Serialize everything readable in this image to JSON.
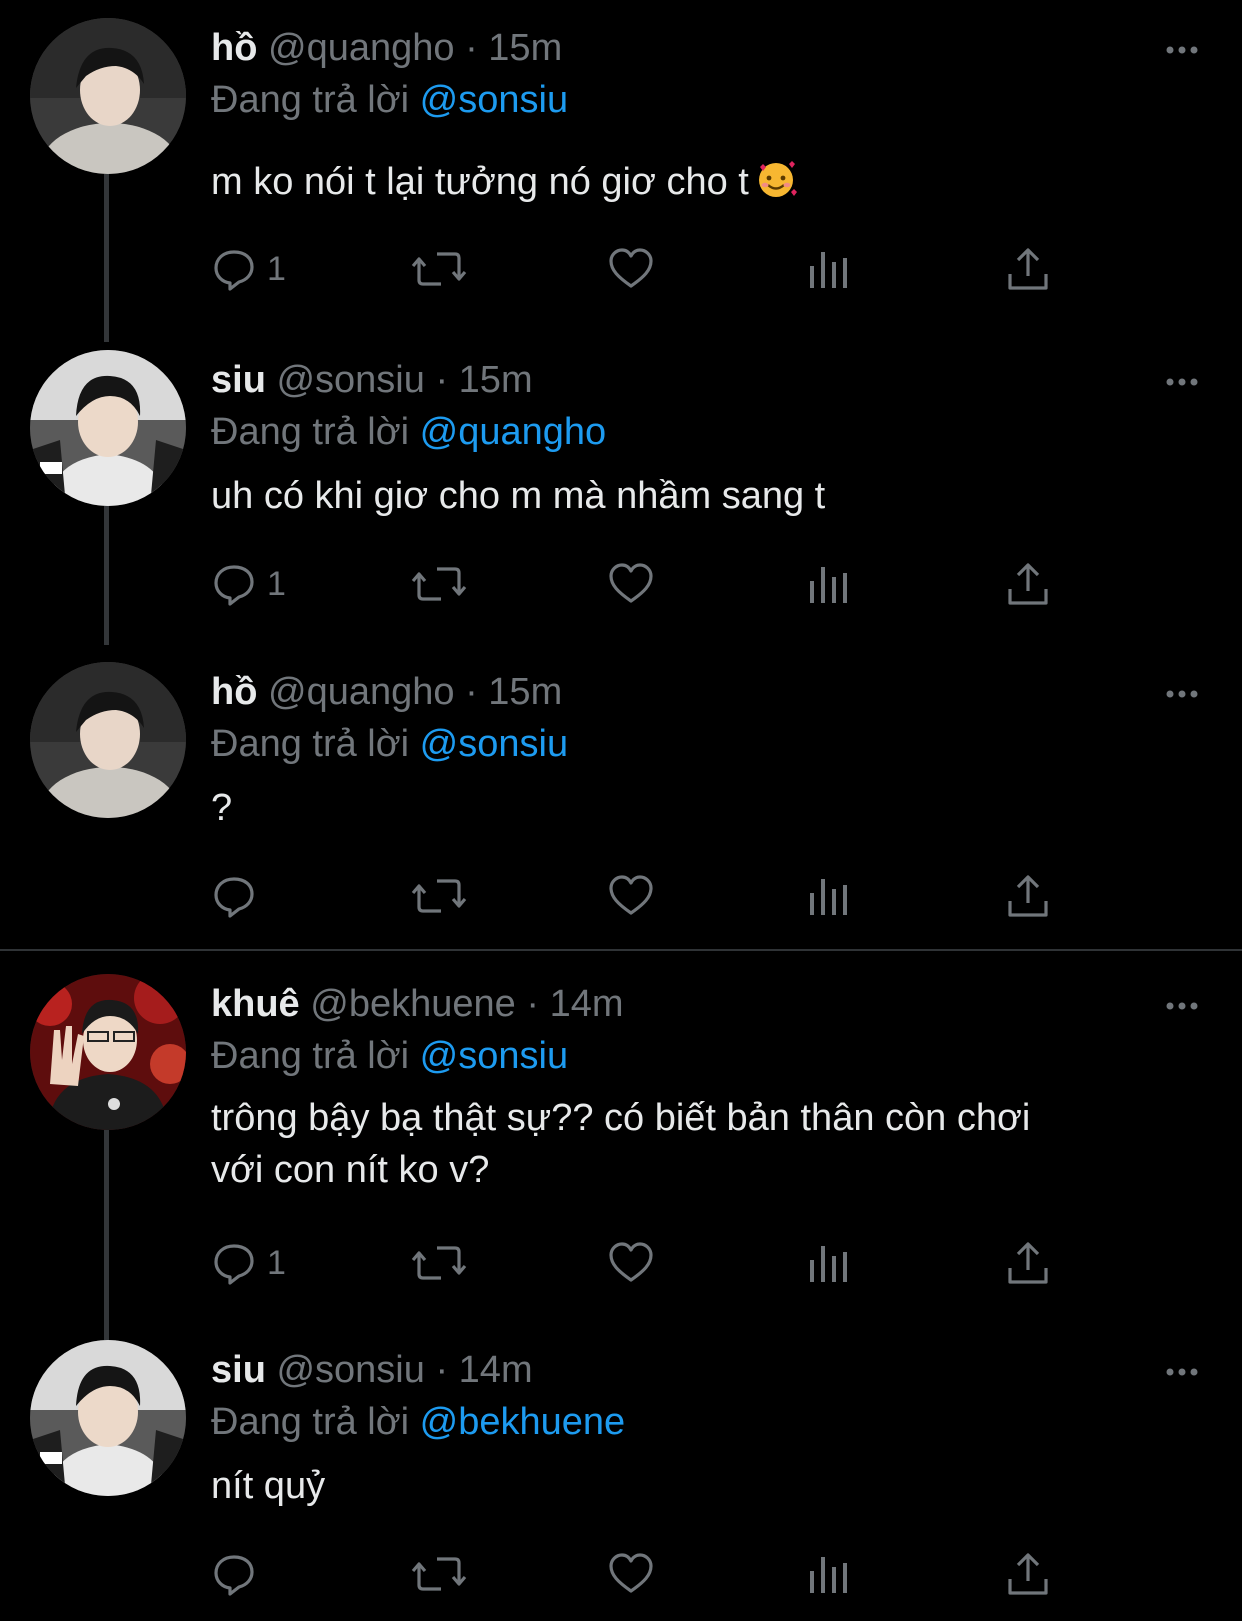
{
  "colors": {
    "background": "#000000",
    "primary_text": "#e7e9ea",
    "secondary_text": "#71767b",
    "link": "#1d9bf0",
    "thread_line": "#333639"
  },
  "tweets": [
    {
      "name": "hồ",
      "handle": "@quangho",
      "separator": "·",
      "time": "15m",
      "reply_prefix": "Đang trả lời",
      "reply_to": "@sonsiu",
      "text": "m ko nói t lại tưởng nó giơ cho t",
      "emoji": "smiling-face-with-hearts",
      "reply_count": "1"
    },
    {
      "name": "siu",
      "handle": "@sonsiu",
      "separator": "·",
      "time": "15m",
      "reply_prefix": "Đang trả lời",
      "reply_to": "@quangho",
      "text": "uh có khi giơ cho m mà nhầm sang t",
      "reply_count": "1"
    },
    {
      "name": "hồ",
      "handle": "@quangho",
      "separator": "·",
      "time": "15m",
      "reply_prefix": "Đang trả lời",
      "reply_to": "@sonsiu",
      "text": "?",
      "reply_count": ""
    },
    {
      "name": "khuê",
      "handle": "@bekhuene",
      "separator": "·",
      "time": "14m",
      "reply_prefix": "Đang trả lời",
      "reply_to": "@sonsiu",
      "text_line1": "trông bậy bạ thật sự?? có biết bản thân còn chơi",
      "text_line2": "với con nít ko v?",
      "reply_count": "1"
    },
    {
      "name": "siu",
      "handle": "@sonsiu",
      "separator": "·",
      "time": "14m",
      "reply_prefix": "Đang trả lời",
      "reply_to": "@bekhuene",
      "text": "nít quỷ",
      "reply_count": ""
    }
  ]
}
